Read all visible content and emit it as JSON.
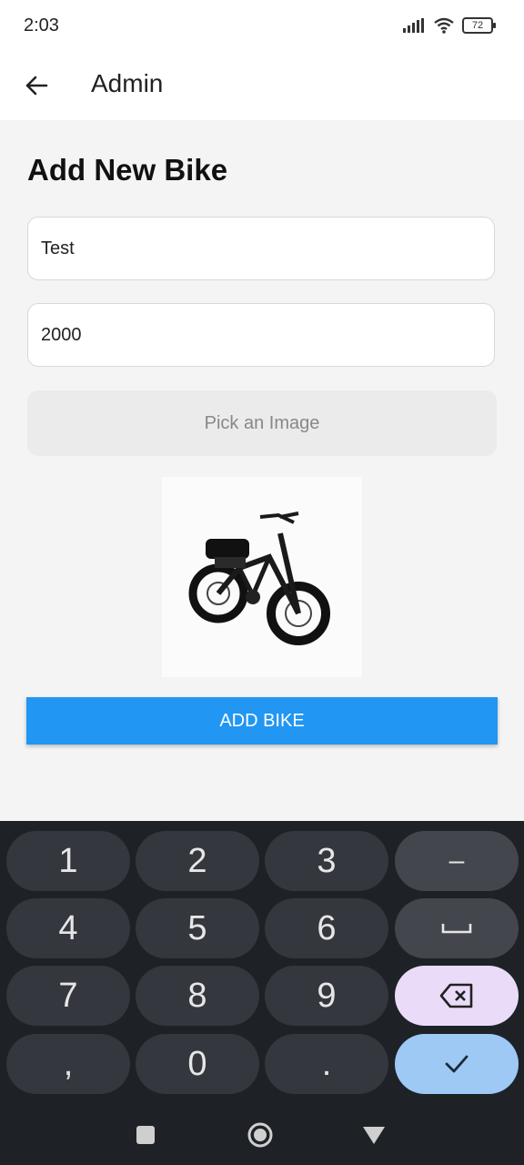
{
  "status": {
    "time": "2:03",
    "battery": "72"
  },
  "app_bar": {
    "title": "Admin"
  },
  "form": {
    "heading": "Add New Bike",
    "name_value": "Test",
    "price_value": "2000",
    "pick_image_label": "Pick an Image",
    "add_button_label": "ADD BIKE"
  },
  "keyboard": {
    "row1": [
      "1",
      "2",
      "3",
      "–"
    ],
    "row2": [
      "4",
      "5",
      "6"
    ],
    "row3": [
      "7",
      "8",
      "9"
    ],
    "row4": [
      ",",
      "0",
      "."
    ]
  },
  "colors": {
    "accent": "#2196f3",
    "delete_key": "#eadcf8",
    "confirm_key": "#9ec9f5"
  }
}
